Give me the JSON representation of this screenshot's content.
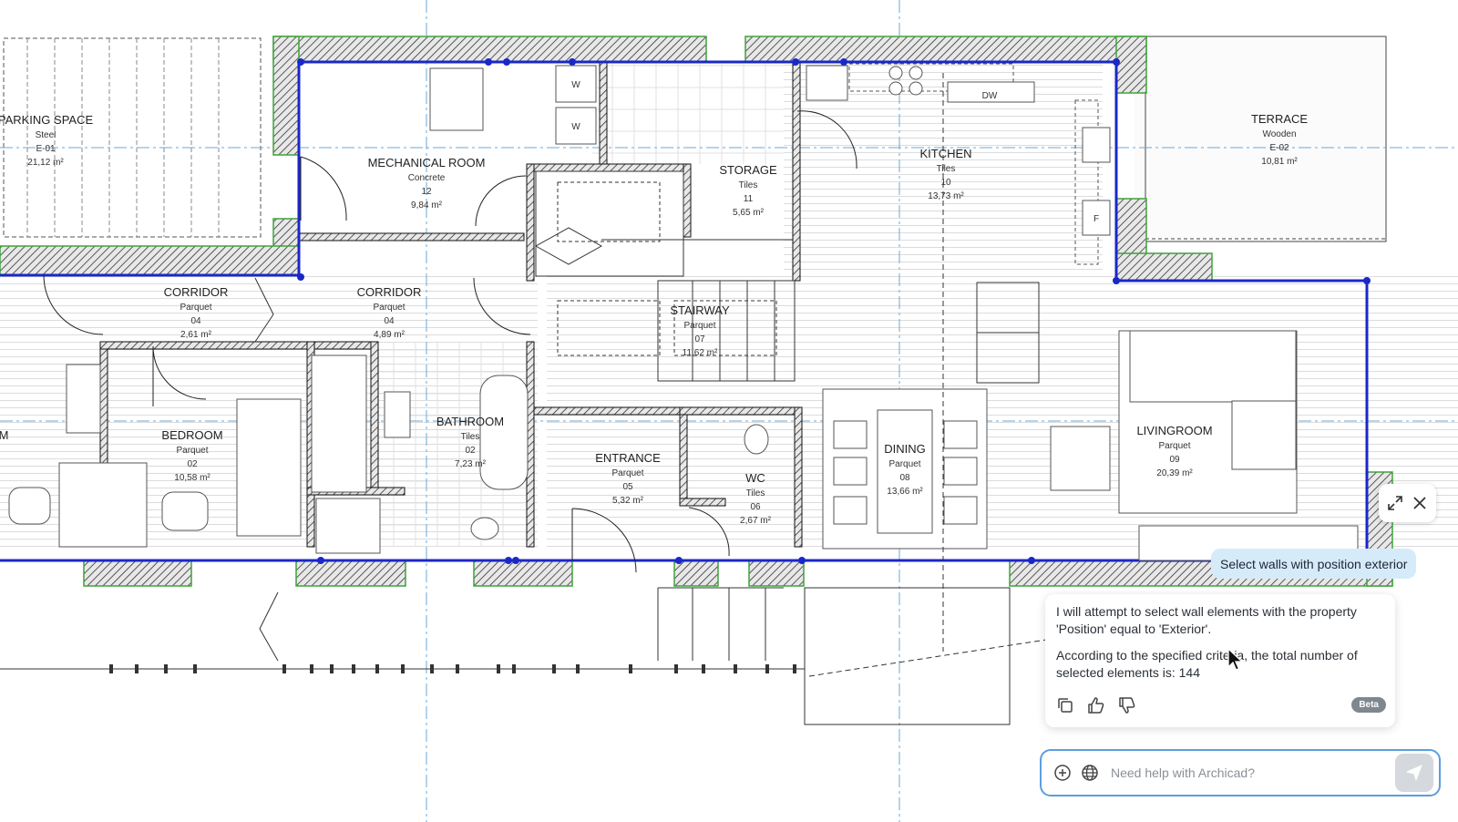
{
  "rooms": [
    {
      "name": "PARKING SPACE",
      "material": "Steel",
      "number": "E-01",
      "area": "21,12 m²"
    },
    {
      "name": "MECHANICAL ROOM",
      "material": "Concrete",
      "number": "12",
      "area": "9,84 m²"
    },
    {
      "name": "STORAGE",
      "material": "Tiles",
      "number": "11",
      "area": "5,65 m²"
    },
    {
      "name": "KITCHEN",
      "material": "Tiles",
      "number": "10",
      "area": "13,73 m²"
    },
    {
      "name": "TERRACE",
      "material": "Wooden",
      "number": "E-02",
      "area": "10,81 m²"
    },
    {
      "name": "CORRIDOR",
      "material": "Parquet",
      "number": "04",
      "area": "2,61 m²"
    },
    {
      "name": "CORRIDOR",
      "material": "Parquet",
      "number": "04",
      "area": "4,89 m²"
    },
    {
      "name": "STAIRWAY",
      "material": "Parquet",
      "number": "07",
      "area": "11,62 m²"
    },
    {
      "name": "BEDROOM",
      "material": "Parquet",
      "number": "02",
      "area": "10,58 m²"
    },
    {
      "name": "BATHROOM",
      "material": "Tiles",
      "number": "02",
      "area": "7,23 m²"
    },
    {
      "name": "ENTRANCE",
      "material": "Parquet",
      "number": "05",
      "area": "5,32 m²"
    },
    {
      "name": "WC",
      "material": "Tiles",
      "number": "06",
      "area": "2,67 m²"
    },
    {
      "name": "DINING",
      "material": "Parquet",
      "number": "08",
      "area": "13,66 m²"
    },
    {
      "name": "LIVINGROOM",
      "material": "Parquet",
      "number": "09",
      "area": "20,39 m²"
    }
  ],
  "plan_labels": {
    "dishwasher": "DW",
    "fridge": "F",
    "washer": "W",
    "dryer": "W",
    "edge_left": "M"
  },
  "chat": {
    "user_message": "Select walls with position exterior",
    "reply_1": "I will attempt to select wall elements with the property 'Position' equal to 'Exterior'.",
    "reply_2": "According to the specified criteria, the total number of selected elements is: 144",
    "badge": "Beta",
    "input_placeholder": "Need help with Archicad?"
  },
  "colors": {
    "selection": "#1a28c8",
    "wall_green": "#3fa33a",
    "accent": "#5b9ee0",
    "grid_axis": "#6aa8d8"
  }
}
